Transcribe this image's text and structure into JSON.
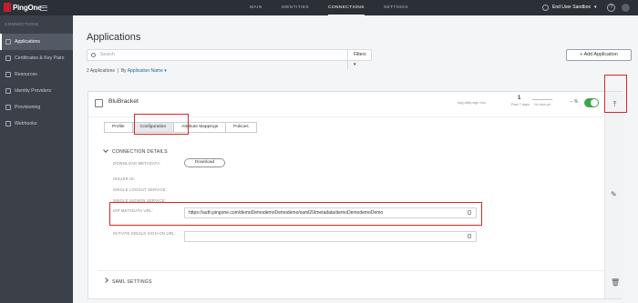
{
  "topbar": {
    "brand": "PingOne",
    "nav": [
      "MAIN",
      "IDENTITIES",
      "CONNECTIONS",
      "SETTINGS"
    ],
    "active_nav": "CONNECTIONS",
    "environment": "End User Sandbox",
    "help": "?"
  },
  "sidebar": {
    "section": "CONNECTIONS",
    "items": [
      {
        "label": "Applications",
        "icon": "applications-icon"
      },
      {
        "label": "Certificates & Key Pairs",
        "icon": "certificate-icon"
      },
      {
        "label": "Resources",
        "icon": "resources-icon"
      },
      {
        "label": "Identity Providers",
        "icon": "identity-providers-icon"
      },
      {
        "label": "Provisioning",
        "icon": "provisioning-icon"
      },
      {
        "label": "Webhooks",
        "icon": "webhooks-icon"
      }
    ],
    "active_index": 0
  },
  "main": {
    "title": "Applications",
    "add_button": "+ Add Application",
    "search_placeholder": "Search",
    "filters": "Filters",
    "count_text": "2 Applications",
    "sort_prefix": "By",
    "sort_value": "Application Name"
  },
  "app": {
    "name": "BluBracket",
    "stat_label": "Avg daily sign-ons",
    "stat_value": "1",
    "stat_sub": "Past 7 days",
    "chart_label": "No data yet",
    "percent": "-- %",
    "enabled": true,
    "tabs": [
      "Profile",
      "Configuration",
      "Attribute Mappings",
      "Policies"
    ],
    "active_tab": "Configuration",
    "connection_details": {
      "heading": "CONNECTION DETAILS",
      "download_metadata_label": "DOWNLOAD METADATA:",
      "download_button": "Download",
      "issuer_id_label": "ISSUER ID:",
      "single_logout_label": "SINGLE LOGOUT SERVICE:",
      "single_signon_label": "SINGLE SIGNON SERVICE:",
      "idp_metadata_label": "IDP METADATA URL:",
      "idp_metadata_value": "https://auth.pingone.com/demoDemodemoDemodemo/saml20/metadata/demoDemodemoDemo",
      "initiate_sso_label": "INITIATE SINGLE SIGN-ON URL:",
      "initiate_sso_value": ""
    },
    "saml_settings_heading": "SAML SETTINGS"
  }
}
